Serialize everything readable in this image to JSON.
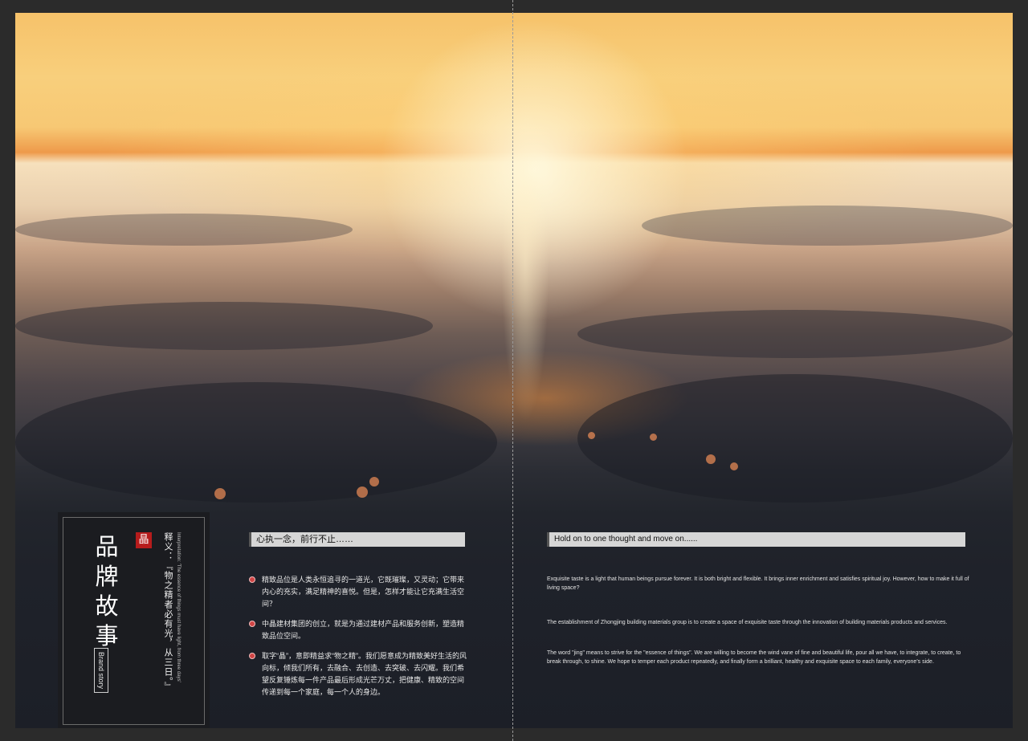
{
  "left_page": {
    "title": "品牌故事",
    "brand_story_label": "Brand story",
    "seal_char": "晶",
    "vertical_cn": "释义：『物之精者必有光，从三日。』",
    "vertical_en": "Interpretation: 'The essence of things must have light, from three days'",
    "slogan": "心执一念，前行不止……",
    "bullets": [
      "精致品位是人类永恒追寻的一道光，它既璀璨，又灵动；它带来内心的充实，满足精神的喜悦。但是，怎样才能让它充满生活空间？",
      "中晶建材集团的创立，就是为通过建材产品和服务创新，塑造精致品位空间。",
      "取字“晶”，意即精益求“物之精”。我们愿意成为精致美好生活的风向标，倾我们所有，去融合、去创造、去突破、去闪耀。我们希望反复锤炼每一件产品最后形成光芒万丈，把健康、精致的空间传递到每一个家庭，每一个人的身边。"
    ]
  },
  "right_page": {
    "slogan": "Hold on to one thought and move on......",
    "paragraphs": [
      "Exquisite taste is a light that human beings pursue forever. It is both bright and flexible. It brings inner enrichment and satisfies spiritual joy. However, how to make it full of living space?",
      "The establishment of Zhongjing building materials group is to create a space of exquisite taste through the innovation of building materials products and services.",
      "The word \"jing\" means to strive for the \"essence of things\". We are willing to become the wind vane of fine and beautiful life, pour all we have, to integrate, to create, to break through, to shine. We hope to temper each product repeatedly, and finally form a brilliant, healthy and exquisite space to each family, everyone's side."
    ]
  },
  "colors": {
    "background": "#2b2b2b",
    "panel": "#1b1c20",
    "accent_red": "#b71c1c",
    "bullet_dot": "#d04545",
    "bar": "#d6d6d6"
  }
}
